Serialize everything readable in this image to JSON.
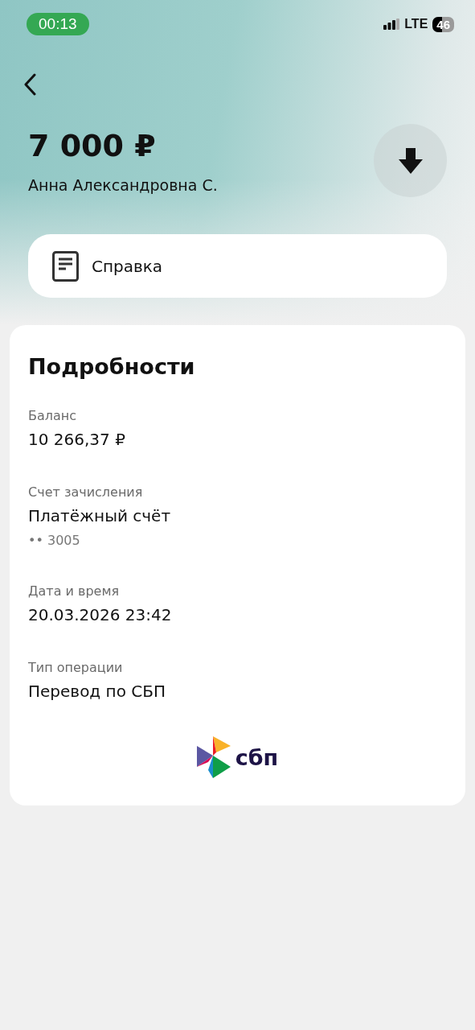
{
  "status_bar": {
    "time": "00:13",
    "network": "LTE",
    "battery": "46"
  },
  "header": {
    "amount": "7 000 ₽",
    "name": "Анна Александровна С."
  },
  "certificate_button": {
    "label": "Справка"
  },
  "details": {
    "title": "Подробности",
    "fields": [
      {
        "label": "Баланс",
        "value": "10 266,37 ₽"
      },
      {
        "label": "Счет зачисления",
        "value": "Платёжный счёт",
        "sub": "•• 3005"
      },
      {
        "label": "Дата и время",
        "value": "20.03.2026 23:42"
      },
      {
        "label": "Тип операции",
        "value": "Перевод по СБП"
      }
    ],
    "logo_text": "сбп"
  }
}
